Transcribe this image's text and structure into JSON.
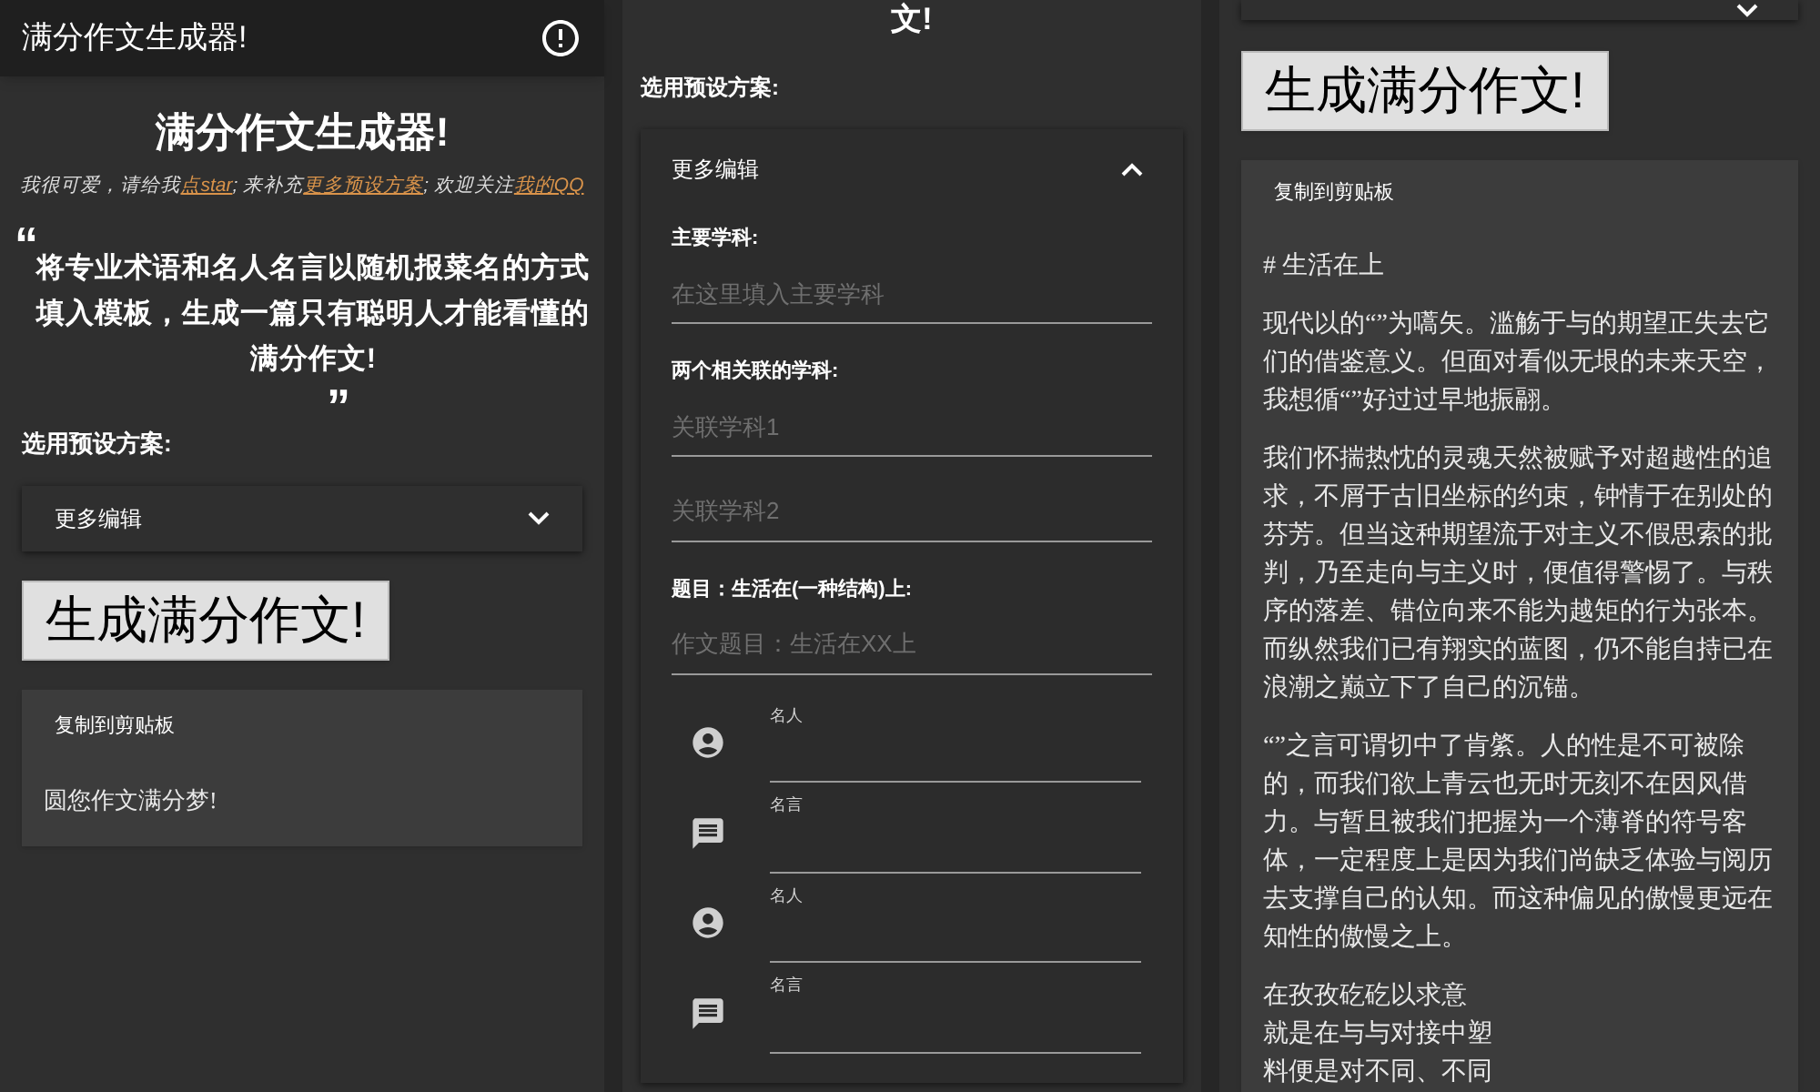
{
  "left_panel": {
    "app_bar": {
      "title": "满分作文生成器!"
    },
    "heading": "满分作文生成器!",
    "tagline": [
      {
        "text": "我很可爱，请给我",
        "link": false
      },
      {
        "text": "点star",
        "link": true
      },
      {
        "text": "; 来补充",
        "link": false
      },
      {
        "text": "更多预设方案",
        "link": true
      },
      {
        "text": "; 欢迎关注",
        "link": false
      },
      {
        "text": "我的QQ",
        "link": true
      }
    ],
    "quote": {
      "open_mark": "“",
      "text": "将专业术语和名人名言以随机报菜名的方式填入模板，生成一篇只有聪明人才能看懂的满分作文!",
      "close_mark": "”"
    },
    "preset_label": "选用预设方案:",
    "accordion": {
      "label": "更多编辑",
      "expanded": false
    },
    "generate_button": "生成满分作文!",
    "output": {
      "copy_button": "复制到剪贴板",
      "text": "圆您作文满分梦!"
    }
  },
  "middle_panel": {
    "heading_tail": "文!",
    "preset_label": "选用预设方案:",
    "accordion": {
      "label": "更多编辑",
      "expanded": true,
      "fields": [
        {
          "label": "主要学科:",
          "placeholders": [
            "在这里填入主要学科"
          ]
        },
        {
          "label": "两个相关联的学科:",
          "placeholders": [
            "关联学科1",
            "关联学科2"
          ]
        },
        {
          "label": "题目：生活在(一种结构)上:",
          "placeholders": [
            "作文题目：生活在XX上"
          ]
        }
      ],
      "entries": [
        {
          "kind": "person",
          "label": "名人"
        },
        {
          "kind": "quote",
          "label": "名言"
        },
        {
          "kind": "person",
          "label": "名人"
        },
        {
          "kind": "quote",
          "label": "名言"
        }
      ]
    }
  },
  "right_panel": {
    "accordion": {
      "expanded": false
    },
    "generate_button": "生成满分作文!",
    "output": {
      "copy_button": "复制到剪贴板",
      "title": "# 生活在上",
      "paragraphs": [
        {
          "kind": "text",
          "text": "现代以的“”为嚆矢。滥觞于与的期望正失去它们的借鉴意义。但面对看似无垠的未来天空，我想循“”好过过早地振翮。"
        },
        {
          "kind": "text",
          "text": "我们怀揣热忱的灵魂天然被赋予对超越性的追求，不屑于古旧坐标的约束，钟情于在别处的芬芳。但当这种期望流于对主义不假思索的批判，乃至走向与主义时，便值得警惕了。与秩序的落差、错位向来不能为越矩的行为张本。而纵然我们已有翔实的蓝图，仍不能自持已在浪潮之巅立下了自己的沉锚。"
        },
        {
          "kind": "text",
          "text": "“”之言可谓切中了肯綮。人的性是不可被除的，而我们欲上青云也无时无刻不在因风借力。与暂且被我们把握为一个薄脊的符号客体，一定程度上是因为我们尚缺乏体验与阅历去支撑自己的认知。而这种偏见的傲慢更远在知性的傲慢之上。"
        },
        {
          "kind": "lines",
          "lines": [
            "在孜孜矻矻以求意",
            "就是在与与对接中塑",
            "料便是对不同、不同"
          ]
        }
      ]
    }
  }
}
